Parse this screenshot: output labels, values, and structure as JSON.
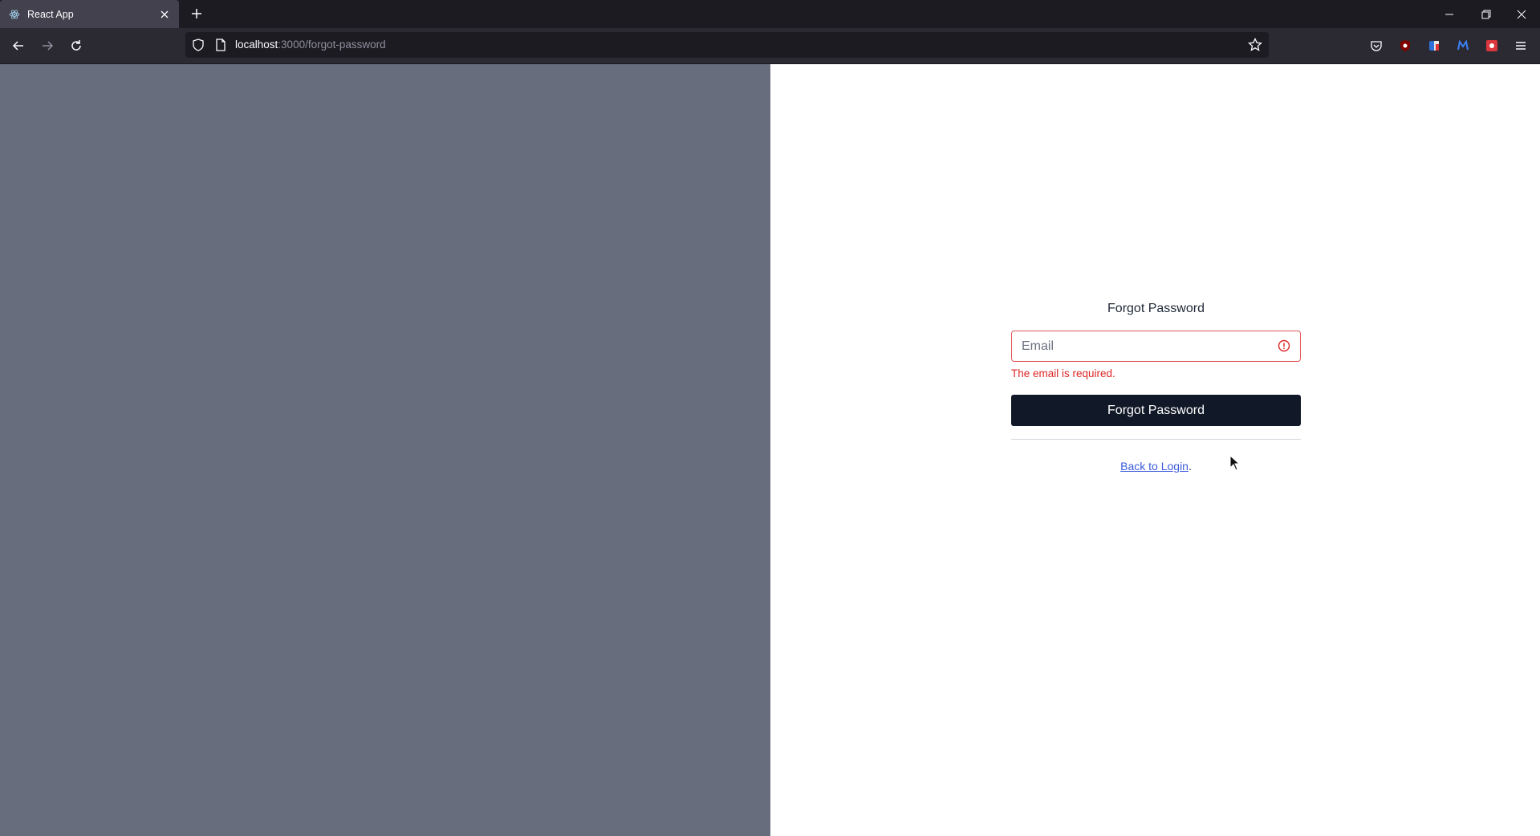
{
  "browser": {
    "tab_title": "React App",
    "url_host": "localhost",
    "url_path": ":3000/forgot-password"
  },
  "form": {
    "title": "Forgot Password",
    "email_placeholder": "Email",
    "email_value": "",
    "error_message": "The email is required.",
    "submit_label": "Forgot Password",
    "back_link_label": "Back to Login",
    "back_link_suffix": "."
  },
  "colors": {
    "left_panel": "#676d7c",
    "button": "#111827",
    "error": "#dc2626",
    "link": "#3b5bdb"
  }
}
